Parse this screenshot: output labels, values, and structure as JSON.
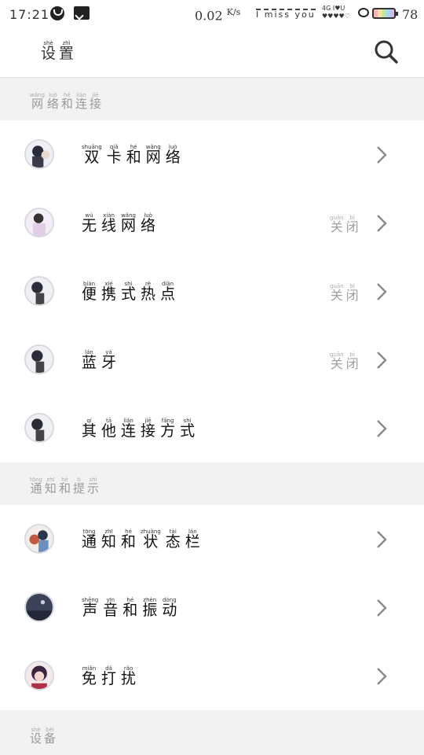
{
  "status_bar": {
    "time": "17:21",
    "speed_value": "0.02",
    "speed_unit": "K/s",
    "signature": "I miss you",
    "network_type": "4G",
    "signal_text": "I♥U",
    "battery_level": "78"
  },
  "header": {
    "title": [
      {
        "ch": "设",
        "py": "shè"
      },
      {
        "ch": "置",
        "py": "zhì"
      }
    ]
  },
  "sections": [
    {
      "title": [
        {
          "ch": "网",
          "py": "wǎng"
        },
        {
          "ch": "络",
          "py": "luò"
        },
        {
          "ch": "和",
          "py": "hé"
        },
        {
          "ch": "连",
          "py": "lián"
        },
        {
          "ch": "接",
          "py": "jiē"
        }
      ],
      "items": [
        {
          "label": [
            {
              "ch": "双",
              "py": "shuāng"
            },
            {
              "ch": "卡",
              "py": "qiǎ"
            },
            {
              "ch": "和",
              "py": "hé"
            },
            {
              "ch": "网",
              "py": "wǎng"
            },
            {
              "ch": "络",
              "py": "luò"
            }
          ],
          "value": []
        },
        {
          "label": [
            {
              "ch": "无",
              "py": "wú"
            },
            {
              "ch": "线",
              "py": "xiàn"
            },
            {
              "ch": "网",
              "py": "wǎng"
            },
            {
              "ch": "络",
              "py": "luò"
            }
          ],
          "value": [
            {
              "ch": "关",
              "py": "guān"
            },
            {
              "ch": "闭",
              "py": "bì"
            }
          ]
        },
        {
          "label": [
            {
              "ch": "便",
              "py": "biàn"
            },
            {
              "ch": "携",
              "py": "xié"
            },
            {
              "ch": "式",
              "py": "shì"
            },
            {
              "ch": "热",
              "py": "rè"
            },
            {
              "ch": "点",
              "py": "diǎn"
            }
          ],
          "value": [
            {
              "ch": "关",
              "py": "guān"
            },
            {
              "ch": "闭",
              "py": "bì"
            }
          ]
        },
        {
          "label": [
            {
              "ch": "蓝",
              "py": "lán"
            },
            {
              "ch": "牙",
              "py": "yá"
            }
          ],
          "value": [
            {
              "ch": "关",
              "py": "guān"
            },
            {
              "ch": "闭",
              "py": "bì"
            }
          ]
        },
        {
          "label": [
            {
              "ch": "其",
              "py": "qí"
            },
            {
              "ch": "他",
              "py": "tā"
            },
            {
              "ch": "连",
              "py": "lián"
            },
            {
              "ch": "接",
              "py": "jiē"
            },
            {
              "ch": "方",
              "py": "fāng"
            },
            {
              "ch": "式",
              "py": "shì"
            }
          ],
          "value": []
        }
      ]
    },
    {
      "title": [
        {
          "ch": "通",
          "py": "tōng"
        },
        {
          "ch": "知",
          "py": "zhī"
        },
        {
          "ch": "和",
          "py": "hé"
        },
        {
          "ch": "提",
          "py": "tí"
        },
        {
          "ch": "示",
          "py": "shì"
        }
      ],
      "items": [
        {
          "label": [
            {
              "ch": "通",
              "py": "tōng"
            },
            {
              "ch": "知",
              "py": "zhī"
            },
            {
              "ch": "和",
              "py": "hé"
            },
            {
              "ch": "状",
              "py": "zhuàng"
            },
            {
              "ch": "态",
              "py": "tài"
            },
            {
              "ch": "栏",
              "py": "lán"
            }
          ],
          "value": []
        },
        {
          "label": [
            {
              "ch": "声",
              "py": "shēng"
            },
            {
              "ch": "音",
              "py": "yīn"
            },
            {
              "ch": "和",
              "py": "hé"
            },
            {
              "ch": "振",
              "py": "zhèn"
            },
            {
              "ch": "动",
              "py": "dòng"
            }
          ],
          "value": []
        },
        {
          "label": [
            {
              "ch": "免",
              "py": "miǎn"
            },
            {
              "ch": "打",
              "py": "dǎ"
            },
            {
              "ch": "扰",
              "py": "rǎo"
            }
          ],
          "value": []
        }
      ]
    },
    {
      "title": [
        {
          "ch": "设",
          "py": "shè"
        },
        {
          "ch": "备",
          "py": "bèi"
        }
      ],
      "items": []
    }
  ]
}
